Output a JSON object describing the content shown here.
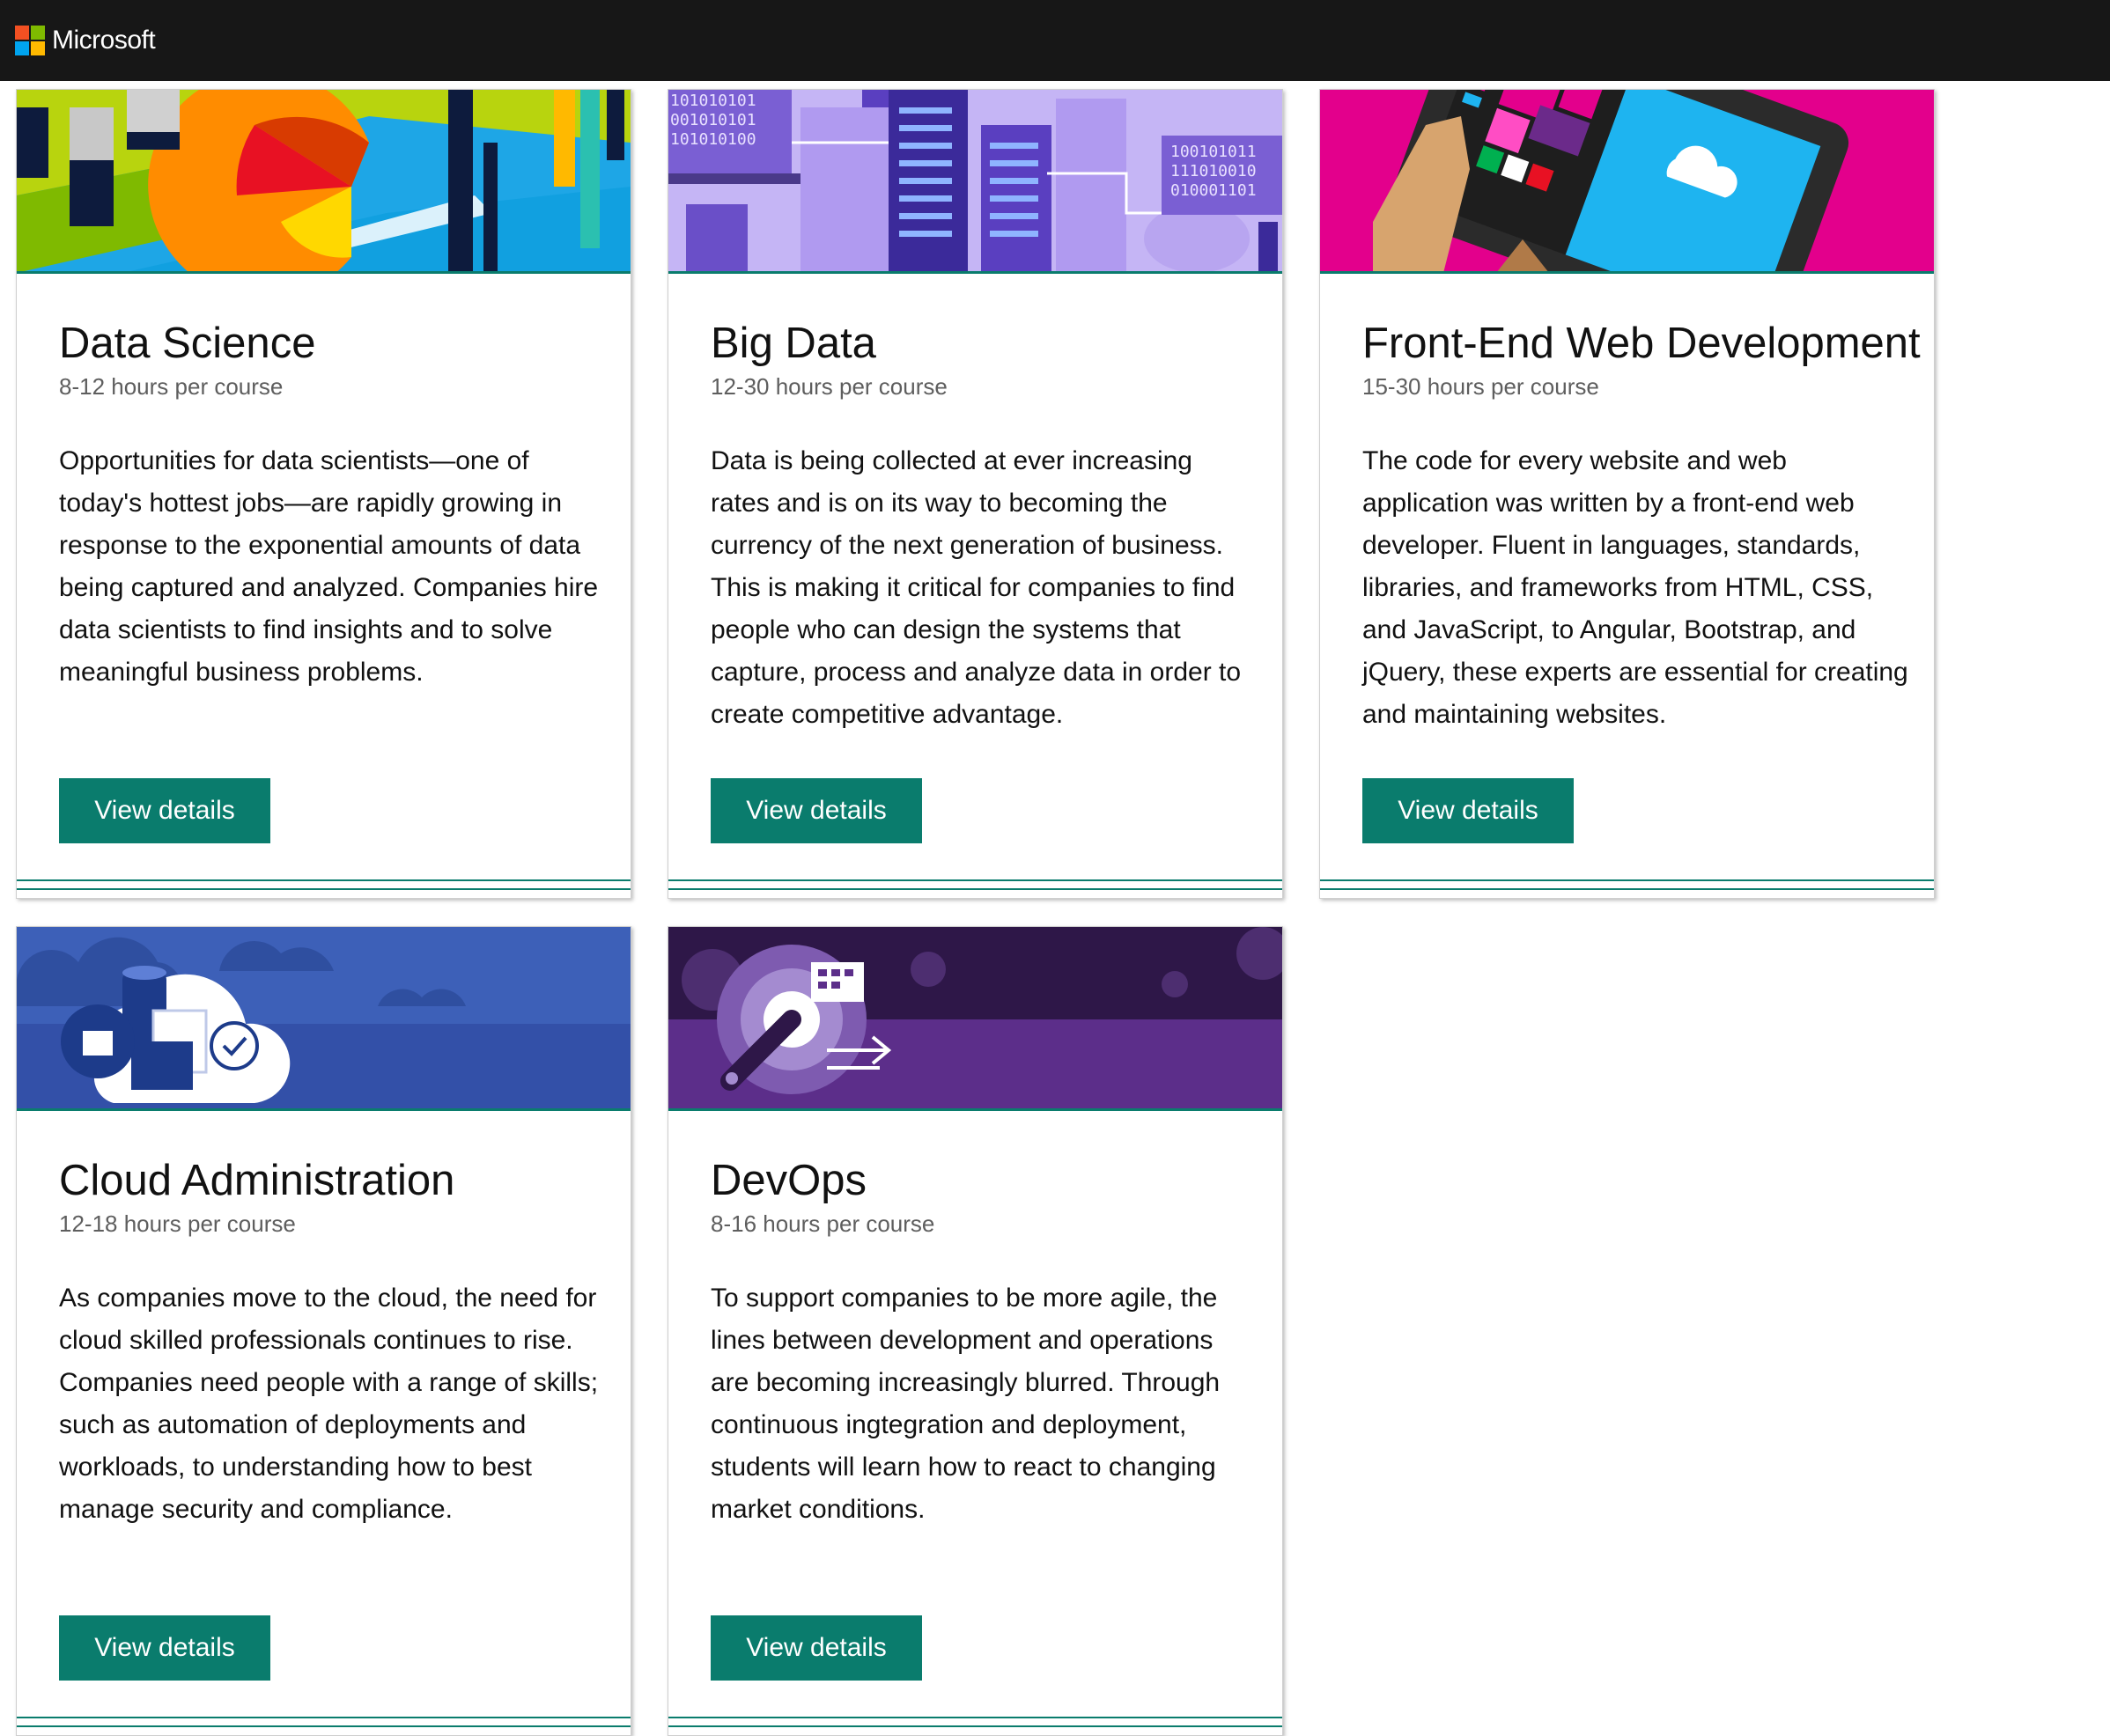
{
  "header": {
    "brand": "Microsoft",
    "logo_colors": [
      "#f25022",
      "#7fba00",
      "#00a4ef",
      "#ffb900"
    ]
  },
  "colors": {
    "accent": "#0a7c6d",
    "header_bg": "#171717"
  },
  "cards": [
    {
      "title": "Data Science",
      "hours": "8-12 hours per course",
      "description": "Opportunities for data scientists—one of today's hottest jobs—are rapidly growing in response to the exponential amounts of data being captured and analyzed. Companies hire data scientists to find insights and to solve meaningful business problems.",
      "button": "View details",
      "banner_icon": "data-chart-illustration"
    },
    {
      "title": "Big Data",
      "hours": "12-30 hours per course",
      "description": "Data is being collected at ever increasing rates and is on its way to becoming the currency of the next generation of business. This is making it critical for companies to find people who can design the systems that capture, process and analyze data in order to create competitive advantage.",
      "button": "View details",
      "banner_icon": "server-binary-illustration",
      "banner_text": [
        "101010101",
        "001010101",
        "101010100",
        "100101011",
        "111010010",
        "010001101"
      ]
    },
    {
      "title": "Front-End Web Development",
      "hours": "15-30 hours per course",
      "description": "The code for every website and web application was written by a front-end web developer. Fluent in languages, standards, libraries, and frameworks from HTML, CSS, and JavaScript, to Angular, Bootstrap, and jQuery, these experts are essential for creating and maintaining websites.",
      "button": "View details",
      "banner_icon": "tablet-illustration"
    },
    {
      "title": "Cloud Administration",
      "hours": "12-18 hours per course",
      "description": "As companies move to the cloud, the need for cloud skilled professionals continues to rise. Companies need people with a range of skills; such as automation of deployments and workloads, to understanding how to best manage security and compliance.",
      "button": "View details",
      "banner_icon": "cloud-security-illustration"
    },
    {
      "title": "DevOps",
      "hours": "8-16 hours per course",
      "description": "To support companies to be more agile, the lines between development and operations are becoming increasingly blurred. Through continuous ingtegration and deployment, students will learn how to react to changing market conditions.",
      "button": "View details",
      "banner_icon": "gear-wrench-illustration"
    }
  ]
}
